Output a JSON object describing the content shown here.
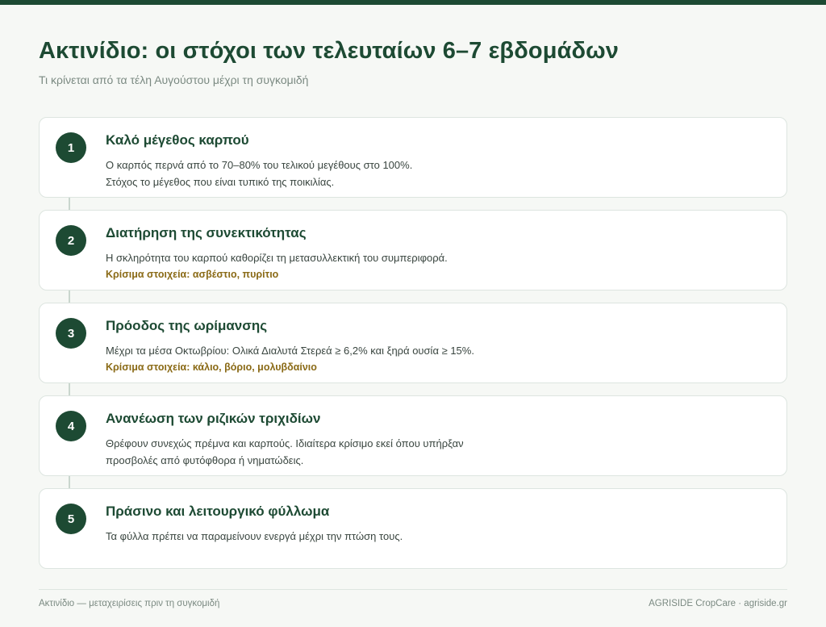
{
  "header": {
    "title": "Ακτινίδιο: οι στόχοι των τελευταίων 6–7 εβδομάδων",
    "subtitle": "Τι κρίνεται από τα τέλη Αυγούστου μέχρι τη συγκομιδή"
  },
  "items": [
    {
      "number": "1",
      "title": "Καλό μέγεθος καρπού",
      "line1": "Ο καρπός περνά από το 70–80% του τελικού μεγέθους στο 100%.",
      "line2": "Στόχος το μέγεθος που είναι τυπικό της ποικιλίας."
    },
    {
      "number": "2",
      "title": "Διατήρηση της συνεκτικότητας",
      "line1": "Η σκληρότητα του καρπού καθορίζει τη μετασυλλεκτική του συμπεριφορά.",
      "key": "Κρίσιμα στοιχεία: ασβέστιο, πυρίτιο"
    },
    {
      "number": "3",
      "title": "Πρόοδος της ωρίμανσης",
      "line1": "Μέχρι τα μέσα Οκτωβρίου: Ολικά Διαλυτά Στερεά ≥ 6,2% και ξηρά ουσία ≥ 15%.",
      "key": "Κρίσιμα στοιχεία: κάλιο, βόριο, μολυβδαίνιο"
    },
    {
      "number": "4",
      "title": "Ανανέωση των ριζικών τριχιδίων",
      "line1": "Θρέφουν συνεχώς πρέμνα και καρπούς. Ιδιαίτερα κρίσιμο εκεί όπου υπήρξαν",
      "line2": "προσβολές από φυτόφθορα ή νηματώδεις."
    },
    {
      "number": "5",
      "title": "Πράσινο και λειτουργικό φύλλωμα",
      "line1": "Τα φύλλα πρέπει να παραμείνουν ενεργά μέχρι την πτώση τους."
    }
  ],
  "footer": {
    "left": "Ακτινίδιο — μεταχειρίσεις πριν τη συγκομιδή",
    "right": "AGRISIDE CropCare · agriside.gr"
  }
}
